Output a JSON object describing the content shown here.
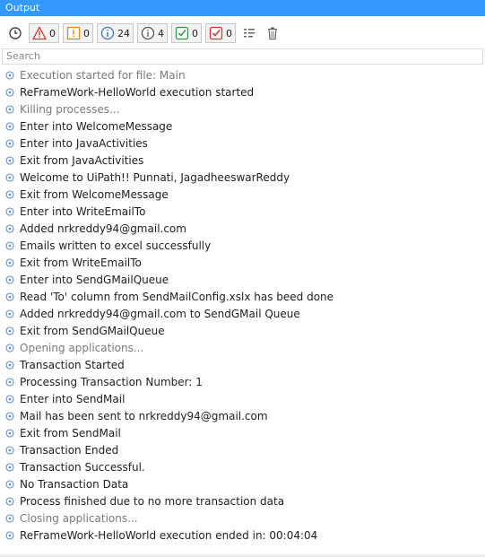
{
  "window": {
    "title": "Output"
  },
  "toolbar": {
    "error_count": "0",
    "warning_count": "0",
    "info_count": "24",
    "trace_count": "4",
    "success_count": "0",
    "failed_count": "0",
    "icons": [
      "history-clock-icon",
      "error-triangle-icon",
      "warning-icon",
      "info-icon",
      "trace-icon",
      "success-check-icon",
      "failed-check-icon",
      "filter-list-icon",
      "trash-icon"
    ]
  },
  "search": {
    "placeholder": "Search"
  },
  "logs": [
    {
      "text": "Execution started for file: Main",
      "muted": true
    },
    {
      "text": "ReFrameWork-HelloWorld execution started",
      "muted": false
    },
    {
      "text": "Killing processes...",
      "muted": true
    },
    {
      "text": "Enter into WelcomeMessage",
      "muted": false
    },
    {
      "text": "Enter into JavaActivities",
      "muted": false
    },
    {
      "text": "Exit from JavaActivities",
      "muted": false
    },
    {
      "text": "Welcome to UiPath!! Punnati, JagadheeswarReddy",
      "muted": false
    },
    {
      "text": "Exit from WelcomeMessage",
      "muted": false
    },
    {
      "text": "Enter into WriteEmailTo",
      "muted": false
    },
    {
      "text": "Added nrkreddy94@gmail.com",
      "muted": false
    },
    {
      "text": "Emails written to excel successfully",
      "muted": false
    },
    {
      "text": "Exit from WriteEmailTo",
      "muted": false
    },
    {
      "text": "Enter into SendGMailQueue",
      "muted": false
    },
    {
      "text": "Read 'To' column from SendMailConfig.xslx has beed done",
      "muted": false
    },
    {
      "text": "Added nrkreddy94@gmail.com to SendGMail Queue",
      "muted": false
    },
    {
      "text": "Exit from SendGMailQueue",
      "muted": false
    },
    {
      "text": "Opening applications...",
      "muted": true
    },
    {
      "text": "Transaction Started",
      "muted": false
    },
    {
      "text": "Processing Transaction Number: 1",
      "muted": false
    },
    {
      "text": "Enter into SendMail",
      "muted": false
    },
    {
      "text": "Mail has been sent to nrkreddy94@gmail.com",
      "muted": false
    },
    {
      "text": "Exit from SendMail",
      "muted": false
    },
    {
      "text": "Transaction Ended",
      "muted": false
    },
    {
      "text": "Transaction Successful.",
      "muted": false
    },
    {
      "text": "No Transaction Data",
      "muted": false
    },
    {
      "text": "Process finished due to no more transaction data",
      "muted": false
    },
    {
      "text": "Closing applications...",
      "muted": true
    },
    {
      "text": "ReFrameWork-HelloWorld execution ended in: 00:04:04",
      "muted": false
    }
  ],
  "colors": {
    "title_bg": "#3399ff",
    "info_icon": "#5b8fd6",
    "muted_text": "#7a7a7a"
  }
}
